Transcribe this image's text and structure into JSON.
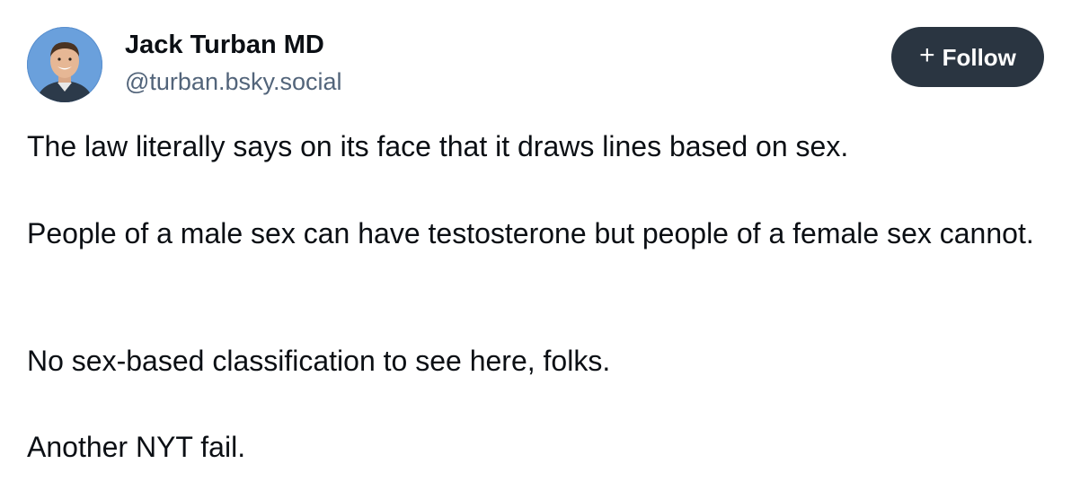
{
  "post": {
    "author": {
      "display_name": "Jack Turban MD",
      "handle": "@turban.bsky.social",
      "avatar_icon": "avatar-photo"
    },
    "follow_button": {
      "icon": "plus-icon",
      "label": "Follow",
      "background": "#2a3541",
      "text_color": "#ffffff"
    },
    "paragraphs": [
      "The law literally says on its face that it draws lines based on sex.",
      "People of a male sex can have testosterone but people of a female sex cannot.",
      "No sex-based classification to see here, folks.",
      "Another NYT fail."
    ]
  },
  "colors": {
    "text_primary": "#0b0f14",
    "text_secondary": "#52647a",
    "background": "#ffffff"
  }
}
